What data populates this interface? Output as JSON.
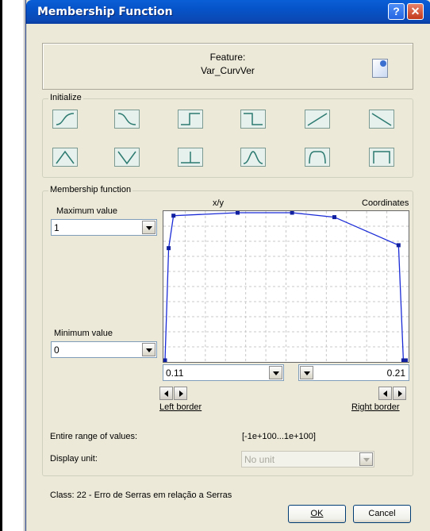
{
  "dialog": {
    "title": "Membership Function",
    "help_glyph": "?",
    "close_glyph": "✕"
  },
  "feature": {
    "label": "Feature:",
    "name": "Var_CurvVer",
    "icon": "document-icon"
  },
  "initialize": {
    "label": "Initialize",
    "shapes_row1": [
      "s-curve-rising",
      "s-curve-falling",
      "step-up",
      "step-down",
      "ramp-up",
      "ramp-down"
    ],
    "shapes_row2": [
      "triangle",
      "v-shape",
      "inverted-t",
      "bell",
      "rounded-trapezoid",
      "rectangle"
    ]
  },
  "membership": {
    "label": "Membership function",
    "xy_label": "x/y",
    "coordinates_label": "Coordinates",
    "max_label": "Maximum value",
    "max_value": "1",
    "min_label": "Minimum value",
    "min_value": "0",
    "left_value": "0.11",
    "right_value": "0.21",
    "left_border_label": "Left border",
    "right_border_label": "Right border"
  },
  "chart_data": {
    "type": "line",
    "title": "",
    "xlabel": "x/y",
    "ylabel": "",
    "xlim": [
      0.11,
      0.21
    ],
    "ylim": [
      0,
      1
    ],
    "grid": true,
    "line_color": "#1a2bd6",
    "series": [
      {
        "x": [
          0.11,
          0.1115,
          0.1135,
          0.14,
          0.1625,
          0.18,
          0.2065,
          0.2085,
          0.2095
        ],
        "y": [
          0.0,
          0.76,
          0.98,
          1.0,
          1.0,
          0.97,
          0.78,
          0.0,
          0.0
        ]
      }
    ]
  },
  "range": {
    "label": "Entire range of values:",
    "value": "[-1e+100...1e+100]"
  },
  "display_unit": {
    "label": "Display unit:",
    "value": "No unit"
  },
  "status": {
    "class_text": "Class: 22 - Erro de Serras em relação a Serras"
  },
  "buttons": {
    "ok": "OK",
    "cancel": "Cancel"
  },
  "colors": {
    "titlebar": "#0a5fd6",
    "dialog_bg": "#ece9d8",
    "curve": "#1a2bd6"
  }
}
